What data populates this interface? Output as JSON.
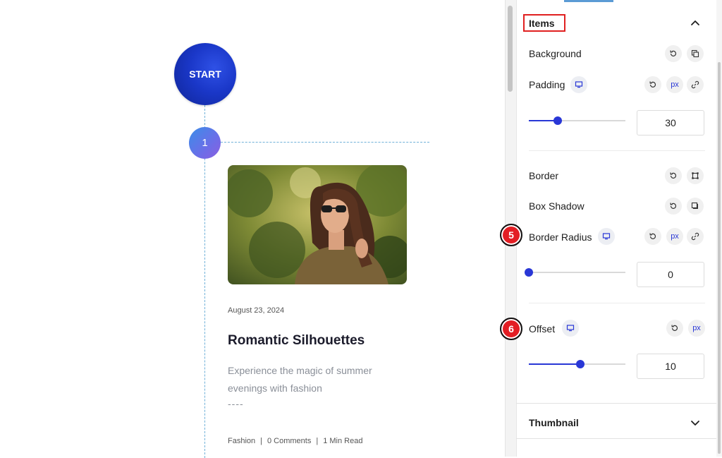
{
  "canvas": {
    "start_label": "START",
    "step_number": "1",
    "post": {
      "date": "August 23, 2024",
      "title": "Romantic Silhouettes",
      "excerpt": "Experience the magic of summer evenings with fashion",
      "excerpt_separator": "----",
      "category": "Fashion",
      "comments": "0 Comments",
      "read_time": "1 Min Read",
      "meta_separator": "|"
    }
  },
  "panel": {
    "items_section": {
      "title": "Items",
      "background_label": "Background",
      "padding_label": "Padding",
      "padding_value": "30",
      "padding_slider_fraction": 0.3,
      "unit_label": "px",
      "border_label": "Border",
      "box_shadow_label": "Box Shadow",
      "border_radius_label": "Border Radius",
      "border_radius_value": "0",
      "border_radius_slider_fraction": 0,
      "offset_label": "Offset",
      "offset_value": "10",
      "offset_slider_fraction": 0.53
    },
    "thumbnail_section": {
      "title": "Thumbnail"
    },
    "annotations": {
      "badge_5": "5",
      "badge_6": "6"
    }
  },
  "colors": {
    "accent": "#2937d6",
    "highlight_red": "#e02020",
    "start_node": "#1a37c8",
    "timeline_line": "#6fb0d8"
  },
  "icons": {
    "reset": "reset-icon",
    "copy": "copy-icon",
    "desktop": "desktop-icon",
    "link": "link-icon",
    "border": "border-icon",
    "shadow": "box-shadow-icon",
    "chevron_up": "chevron-up-icon",
    "chevron_down": "chevron-down-icon"
  }
}
